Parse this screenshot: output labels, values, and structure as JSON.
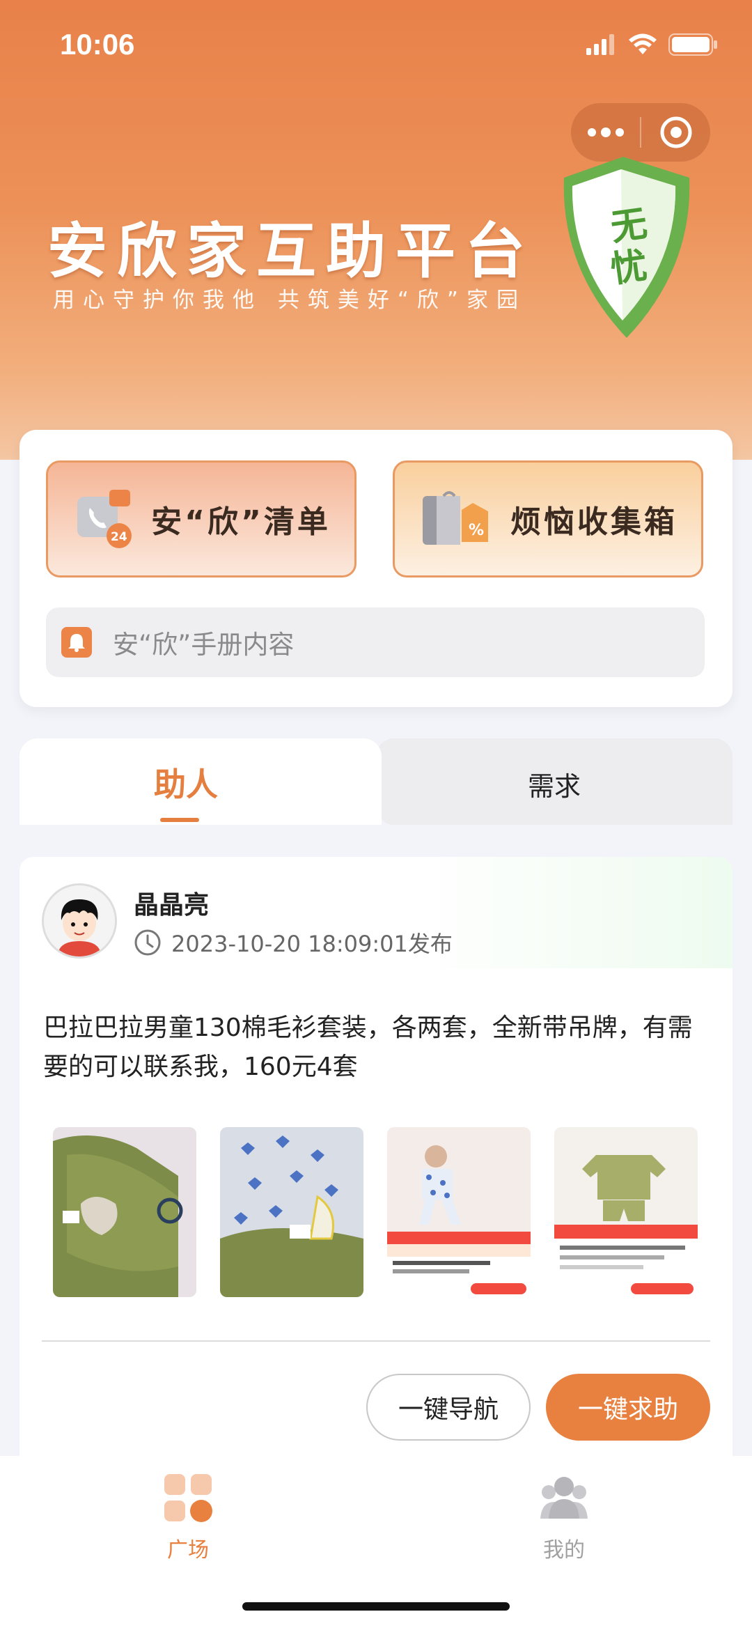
{
  "status_bar": {
    "time": "10:06"
  },
  "header": {
    "title": "安欣家互助平台",
    "subtitle": "用心守护你我他  共筑美好“欣”家园",
    "shield_text": "无忧"
  },
  "quick_actions": {
    "list_label": "安“欣”清单",
    "box_label": "烦恼收集箱",
    "list_badge": "24",
    "manual_placeholder": "安“欣”手册内容"
  },
  "tabs": [
    {
      "label": "助人",
      "active": true
    },
    {
      "label": "需求",
      "active": false
    }
  ],
  "post": {
    "user_name": "晶晶亮",
    "publish_time": "2023-10-20 18:09:01发布",
    "content": "巴拉巴拉男童130棉毛衫套装，各两套，全新带吊牌，有需要的可以联系我，160元4套",
    "images": [
      "clothes-photo-1",
      "clothes-photo-2",
      "product-screenshot-1",
      "product-screenshot-2"
    ],
    "nav_button": "一键导航",
    "help_button": "一键求助"
  },
  "tabbar": {
    "items": [
      {
        "label": "广场",
        "icon": "grid-icon",
        "active": true
      },
      {
        "label": "我的",
        "icon": "people-icon",
        "active": false
      }
    ]
  },
  "colors": {
    "accent": "#e8813f",
    "header": "#ec9158"
  }
}
